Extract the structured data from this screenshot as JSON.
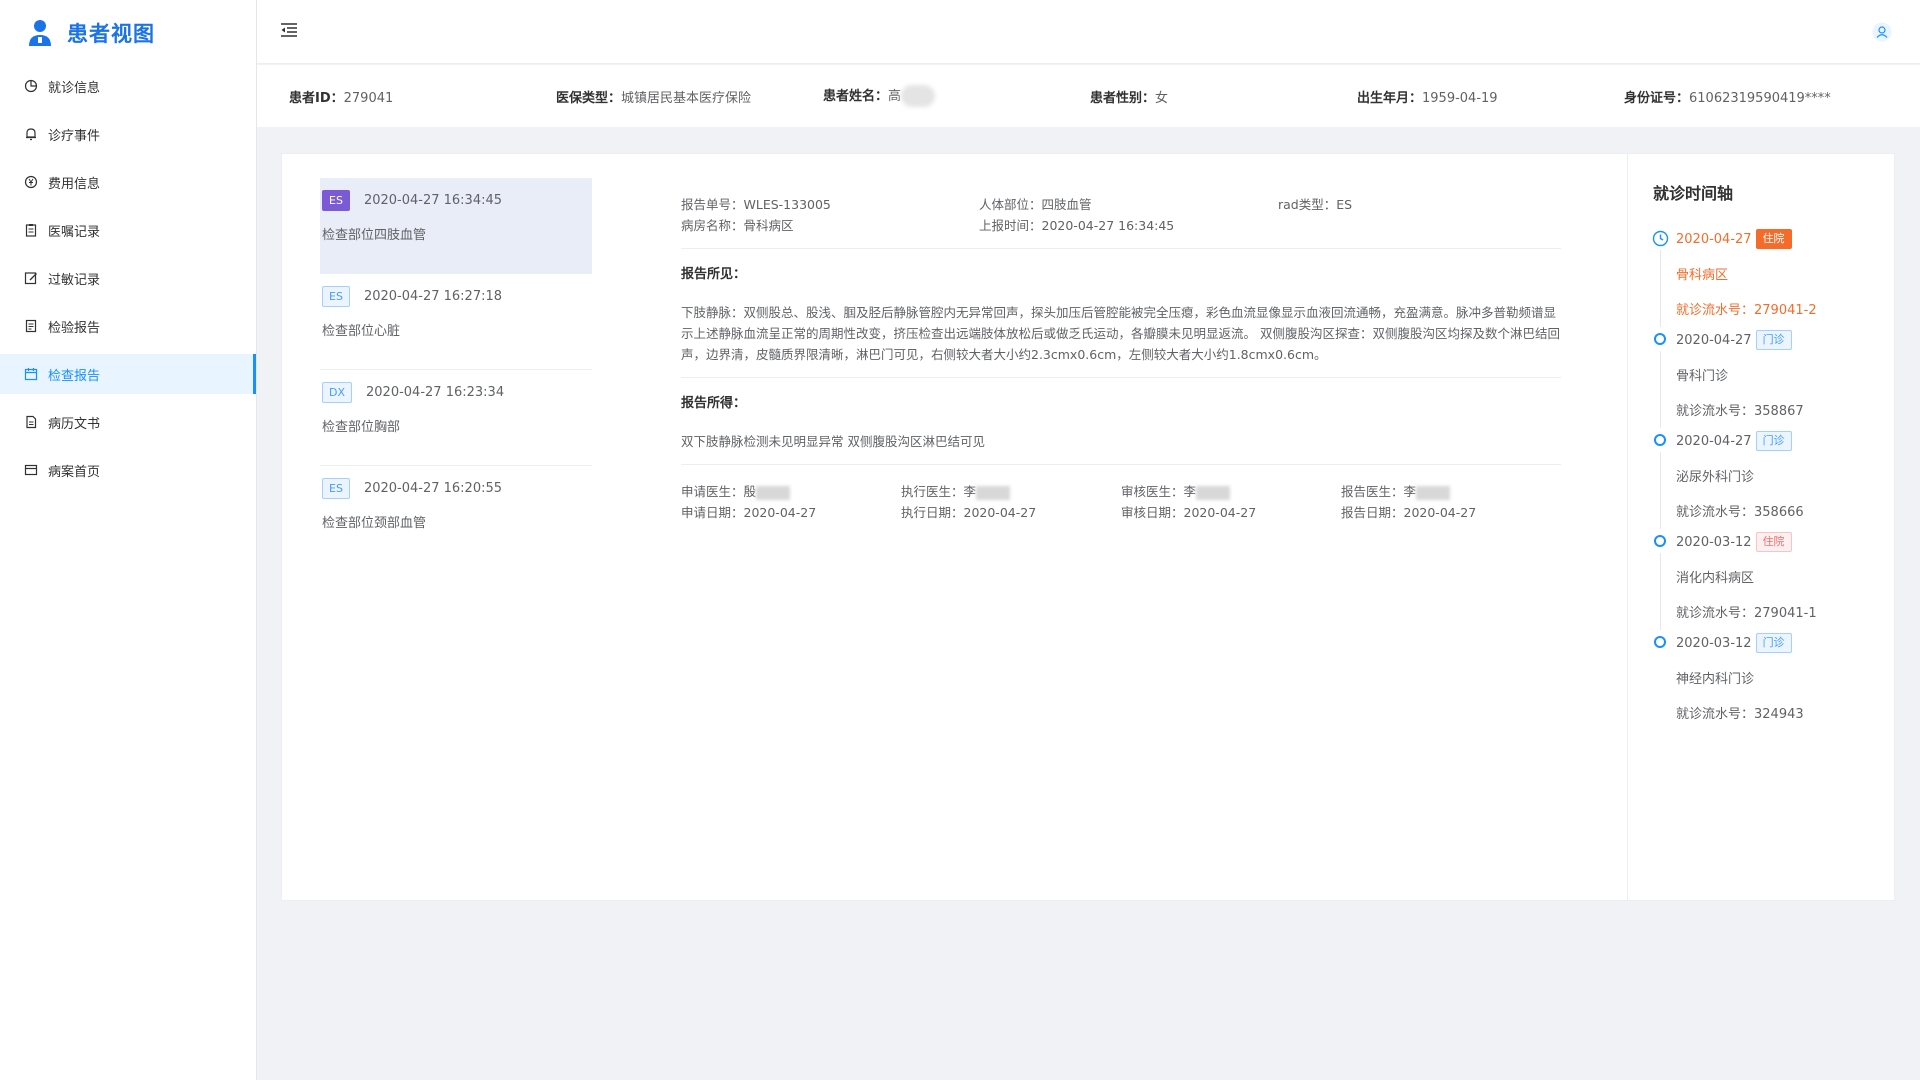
{
  "app": {
    "title": "患者视图"
  },
  "sidebar": {
    "items": [
      {
        "label": "就诊信息",
        "icon": "pie-chart-icon"
      },
      {
        "label": "诊疗事件",
        "icon": "bell-icon"
      },
      {
        "label": "费用信息",
        "icon": "currency-icon"
      },
      {
        "label": "医嘱记录",
        "icon": "clipboard-icon"
      },
      {
        "label": "过敏记录",
        "icon": "edit-icon"
      },
      {
        "label": "检验报告",
        "icon": "test-report-icon"
      },
      {
        "label": "检查报告",
        "icon": "calendar-icon",
        "active": true
      },
      {
        "label": "病历文书",
        "icon": "document-icon"
      },
      {
        "label": "病案首页",
        "icon": "card-icon"
      }
    ]
  },
  "patient": {
    "id_label": "患者ID：",
    "id": "279041",
    "insurance_label": "医保类型：",
    "insurance": "城镇居民基本医疗保险",
    "name_label": "患者姓名：",
    "name": "高",
    "gender_label": "患者性别：",
    "gender": "女",
    "birth_label": "出生年月：",
    "birth": "1959-04-19",
    "idcard_label": "身份证号：",
    "idcard": "61062319590419****"
  },
  "reports": [
    {
      "tag": "ES",
      "time": "2020-04-27 16:34:45",
      "part": "检查部位四肢血管",
      "selected": true
    },
    {
      "tag": "ES",
      "time": "2020-04-27 16:27:18",
      "part": "检查部位心脏"
    },
    {
      "tag": "DX",
      "time": "2020-04-27 16:23:34",
      "part": "检查部位胸部"
    },
    {
      "tag": "ES",
      "time": "2020-04-27 16:20:55",
      "part": "检查部位颈部血管"
    }
  ],
  "detail": {
    "report_no": "报告单号：WLES-133005",
    "body_part": "人体部位：四肢血管",
    "rad_type": "rad类型：ES",
    "ward": "病房名称：骨科病区",
    "report_time": "上报时间：2020-04-27 16:34:45",
    "findings_title": "报告所见：",
    "findings": "下肢静脉：双侧股总、股浅、腘及胫后静脉管腔内无异常回声，探头加压后管腔能被完全压瘪，彩色血流显像显示血液回流通畅，充盈满意。脉冲多普勒频谱显示上述静脉血流呈正常的周期性改变，挤压检查出远端肢体放松后或做乏氏运动，各瓣膜未见明显返流。 双侧腹股沟区探查：双侧腹股沟区均探及数个淋巴结回声，边界清，皮髓质界限清晰，淋巴门可见，右侧较大者大小约2.3cmx0.6cm，左侧较大者大小约1.8cmx0.6cm。",
    "conclusion_title": "报告所得：",
    "conclusion": "双下肢静脉检测未见明显异常 双侧腹股沟区淋巴结可见",
    "apply_doctor": "申请医生：殷",
    "apply_date": "申请日期：2020-04-27",
    "exec_doctor": "执行医生：李",
    "exec_date": "执行日期：2020-04-27",
    "review_doctor": "审核医生：李",
    "review_date": "审核日期：2020-04-27",
    "report_doctor": "报告医生：李",
    "report_date": "报告日期：2020-04-27"
  },
  "timeline": {
    "title": "就诊时间轴",
    "entries": [
      {
        "date": "2020-04-27",
        "type": "住院",
        "dept": "骨科病区",
        "serial": "就诊流水号：279041-2",
        "current": true
      },
      {
        "date": "2020-04-27",
        "type": "门诊",
        "dept": "骨科门诊",
        "serial": "就诊流水号：358867"
      },
      {
        "date": "2020-04-27",
        "type": "门诊",
        "dept": "泌尿外科门诊",
        "serial": "就诊流水号：358666"
      },
      {
        "date": "2020-03-12",
        "type": "住院",
        "dept": "消化内科病区",
        "serial": "就诊流水号：279041-1"
      },
      {
        "date": "2020-03-12",
        "type": "门诊",
        "dept": "神经内科门诊",
        "serial": "就诊流水号：324943"
      }
    ]
  },
  "colors": {
    "accent": "#1890ff",
    "current": "#f56c2a",
    "es_tag": "#7b5ad6"
  }
}
